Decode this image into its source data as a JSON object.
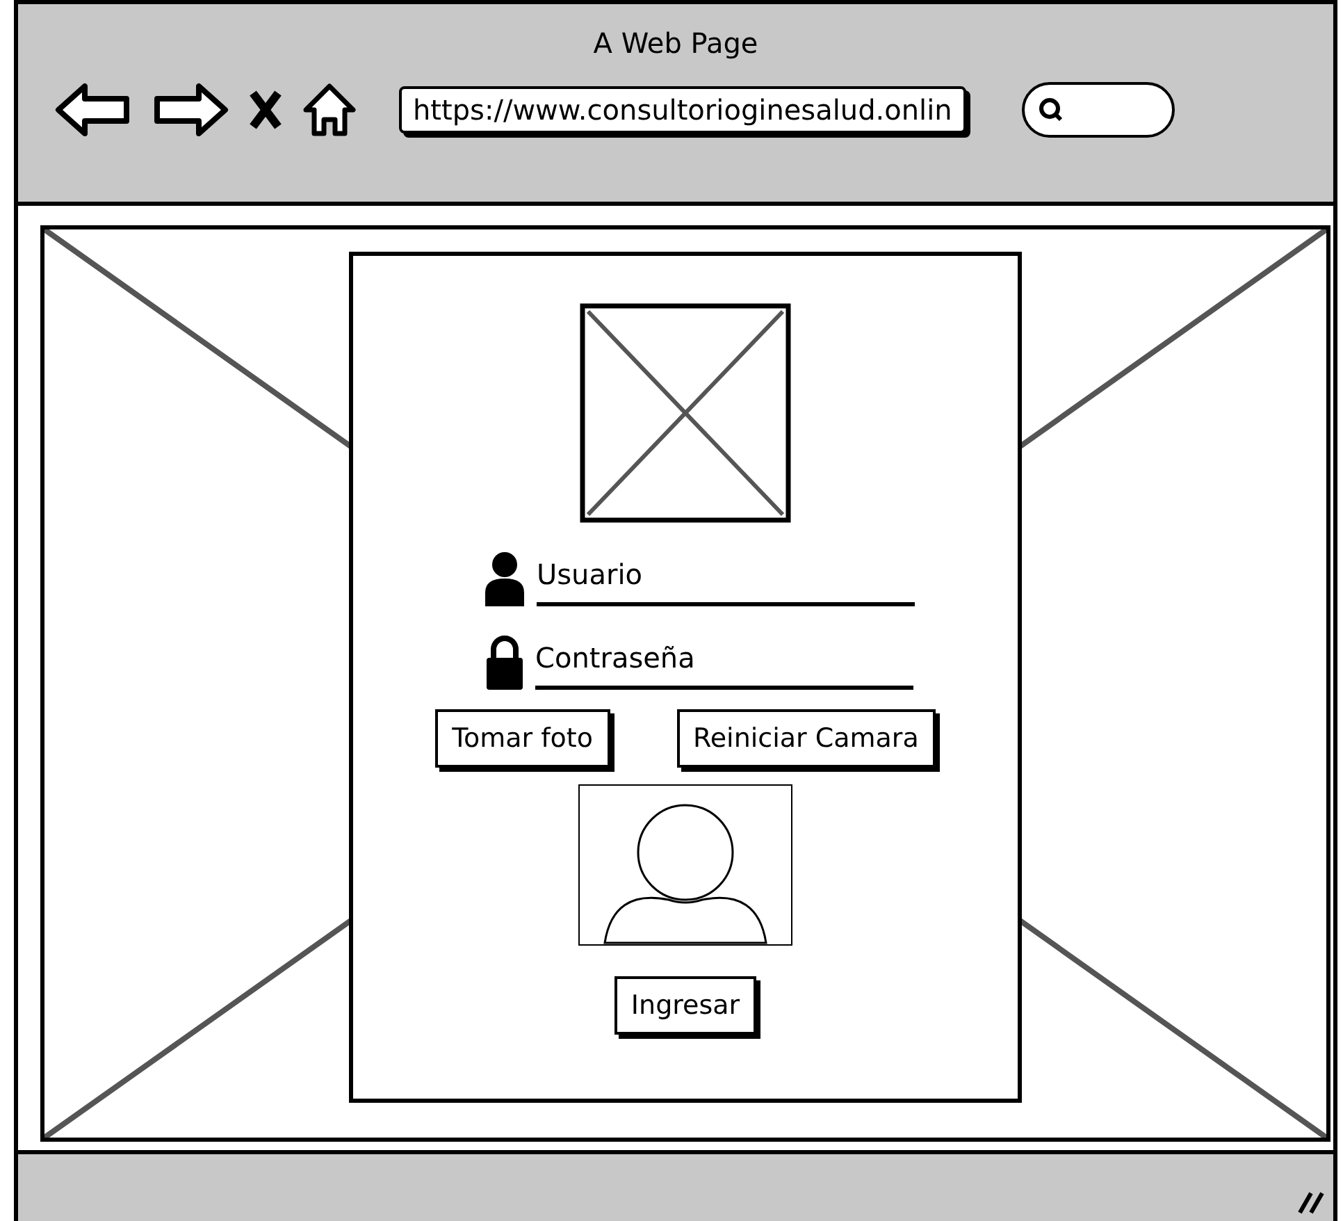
{
  "window": {
    "title": "A Web Page"
  },
  "toolbar": {
    "url": "https://www.consultorioginesalud.onlin"
  },
  "login": {
    "fields": [
      {
        "kind": "user",
        "placeholder": "Usuario"
      },
      {
        "kind": "password",
        "placeholder": "Contraseña"
      }
    ],
    "buttons": [
      "Tomar foto",
      "Reiniciar Camara"
    ],
    "submit": "Ingresar"
  }
}
